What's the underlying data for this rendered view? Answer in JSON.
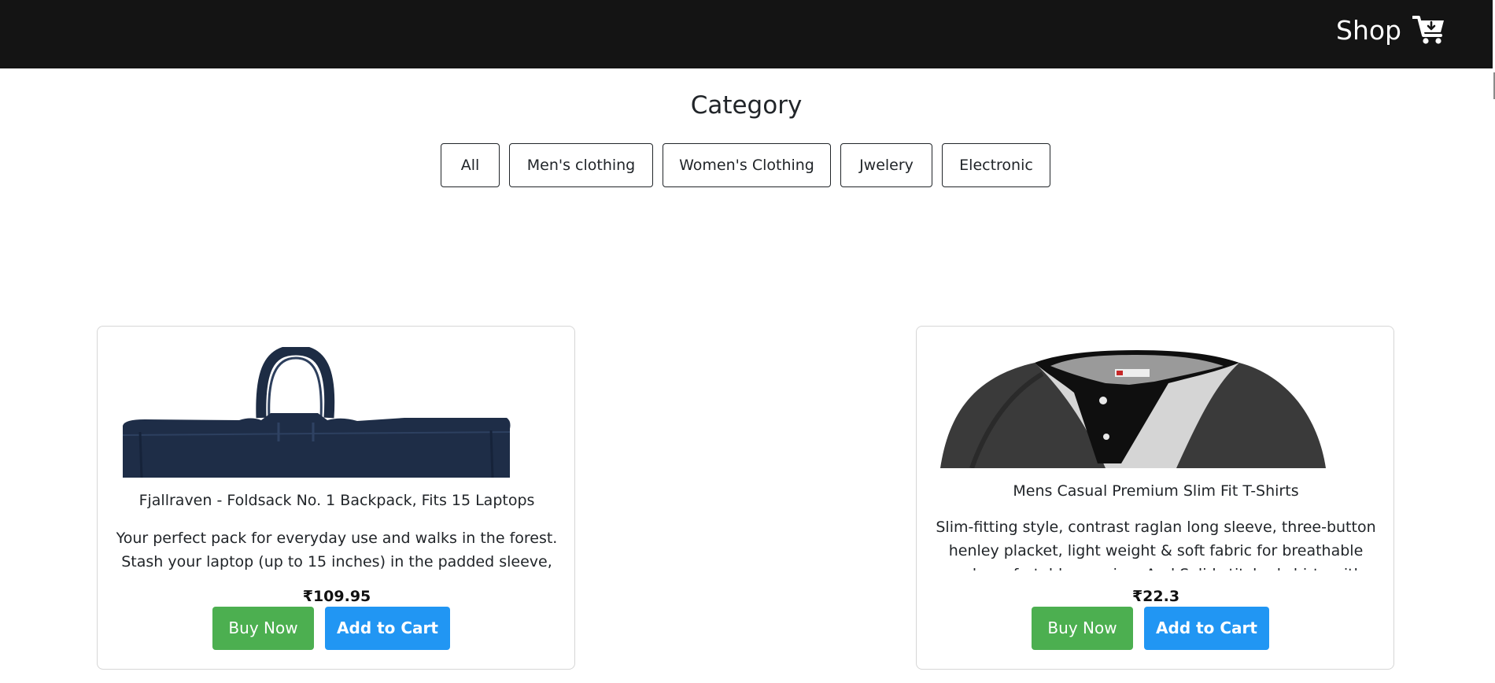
{
  "navbar": {
    "brand": "Shop",
    "cart_icon": "cart-download-icon"
  },
  "category": {
    "title": "Category",
    "buttons": [
      "All",
      "Men's clothing",
      "Women's Clothing",
      "Jwelery",
      "Electronic"
    ]
  },
  "products": [
    {
      "image": "backpack-image",
      "title": "Fjallraven - Foldsack No. 1 Backpack, Fits 15 Laptops",
      "description": "Your perfect pack for everyday use and walks in the forest. Stash your laptop (up to 15 inches) in the padded sleeve, your everyday",
      "price": "₹109.95",
      "buy_label": "Buy Now",
      "cart_label": "Add to Cart"
    },
    {
      "image": "tshirt-image",
      "title": "Mens Casual Premium Slim Fit T-Shirts",
      "description": "Slim-fitting style, contrast raglan long sleeve, three-button henley placket, light weight & soft fabric for breathable and comfortable wearing. And Solid stitched shirts with round neck",
      "price": "₹22.3",
      "buy_label": "Buy Now",
      "cart_label": "Add to Cart"
    }
  ],
  "colors": {
    "navbar_bg": "#141414",
    "buy_button": "#4caf50",
    "cart_button": "#2196f3"
  }
}
